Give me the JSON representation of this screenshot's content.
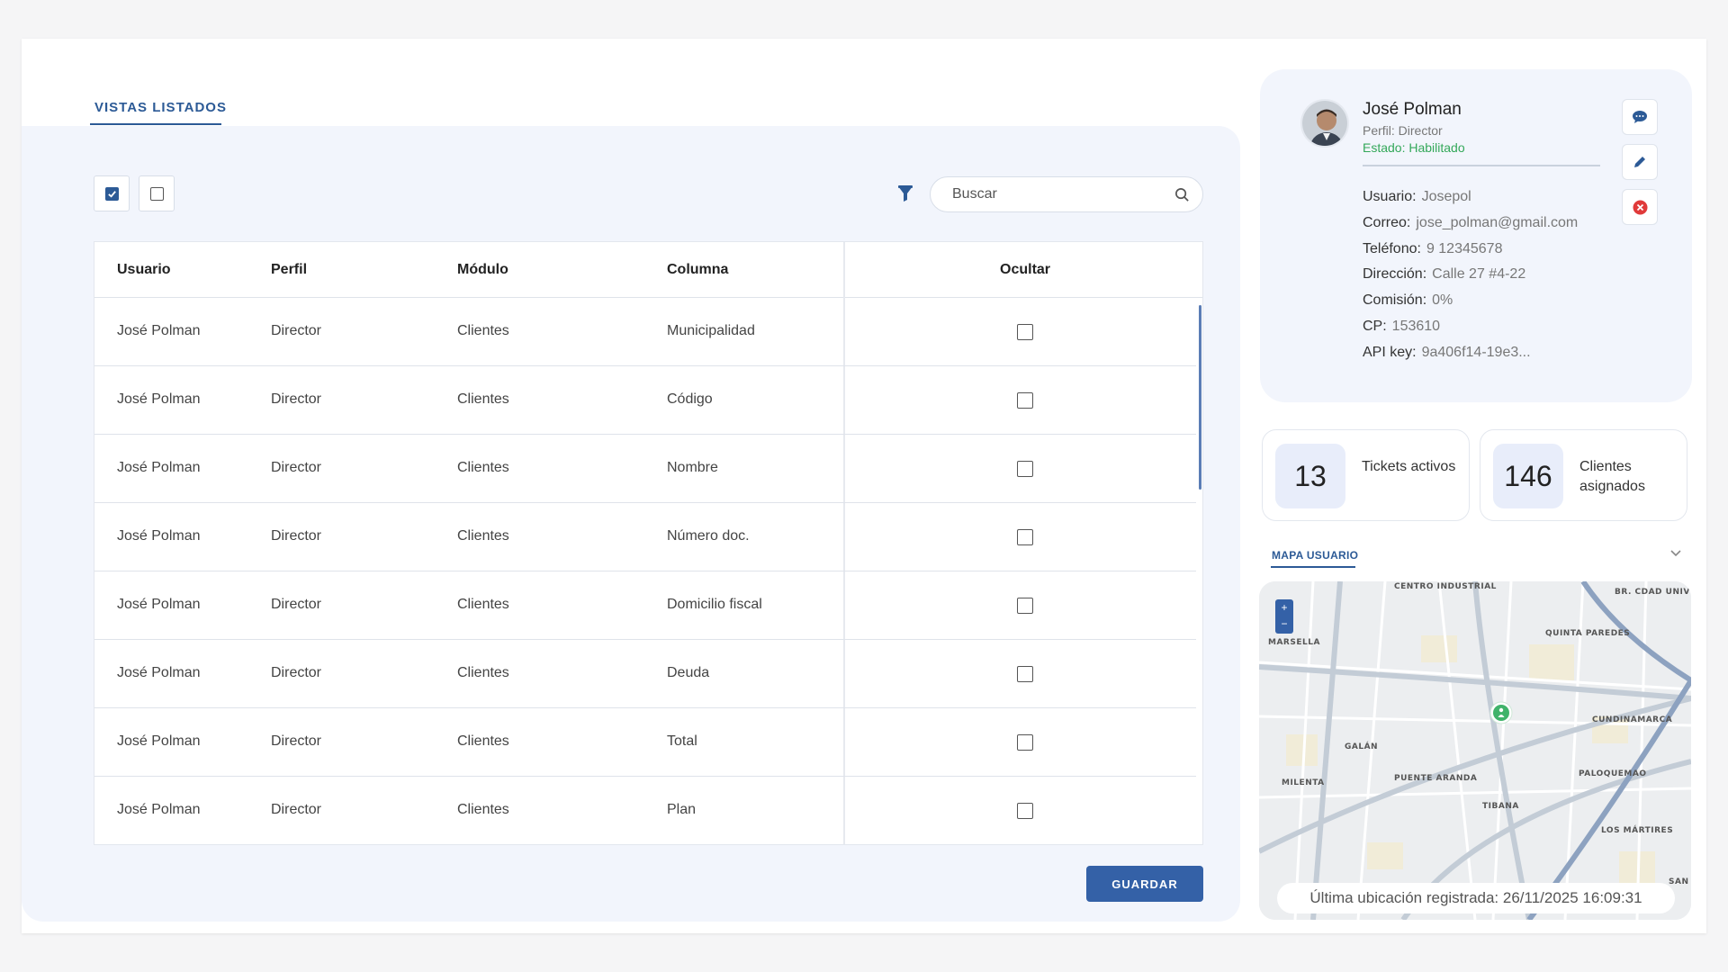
{
  "tab": {
    "label": "VISTAS LISTADOS"
  },
  "search": {
    "placeholder": "Buscar",
    "value": ""
  },
  "table": {
    "headers": {
      "usuario": "Usuario",
      "perfil": "Perfil",
      "modulo": "Módulo",
      "columna": "Columna",
      "ocultar": "Ocultar"
    },
    "rows": [
      {
        "usuario": "José Polman",
        "perfil": "Director",
        "modulo": "Clientes",
        "columna": "Municipalidad",
        "ocultar": false
      },
      {
        "usuario": "José Polman",
        "perfil": "Director",
        "modulo": "Clientes",
        "columna": "Código",
        "ocultar": false
      },
      {
        "usuario": "José Polman",
        "perfil": "Director",
        "modulo": "Clientes",
        "columna": "Nombre",
        "ocultar": false
      },
      {
        "usuario": "José Polman",
        "perfil": "Director",
        "modulo": "Clientes",
        "columna": "Número doc.",
        "ocultar": false
      },
      {
        "usuario": "José Polman",
        "perfil": "Director",
        "modulo": "Clientes",
        "columna": "Domicilio fiscal",
        "ocultar": false
      },
      {
        "usuario": "José Polman",
        "perfil": "Director",
        "modulo": "Clientes",
        "columna": "Deuda",
        "ocultar": false
      },
      {
        "usuario": "José Polman",
        "perfil": "Director",
        "modulo": "Clientes",
        "columna": "Total",
        "ocultar": false
      },
      {
        "usuario": "José Polman",
        "perfil": "Director",
        "modulo": "Clientes",
        "columna": "Plan",
        "ocultar": false
      }
    ]
  },
  "save_button": {
    "label": "GUARDAR"
  },
  "profile": {
    "name": "José Polman",
    "perfil": "Perfil: Director",
    "estado": "Estado: Habilitado",
    "fields": [
      {
        "key": "Usuario:",
        "value": "Josepol"
      },
      {
        "key": "Correo:",
        "value": "jose_polman@gmail.com"
      },
      {
        "key": "Teléfono:",
        "value": "9 12345678"
      },
      {
        "key": "Dirección:",
        "value": "Calle 27 #4-22"
      },
      {
        "key": "Comisión:",
        "value": "0%"
      },
      {
        "key": "CP:",
        "value": "153610"
      },
      {
        "key": "API key:",
        "value": "9a406f14-19e3..."
      }
    ]
  },
  "stats": [
    {
      "value": "13",
      "label": "Tickets activos"
    },
    {
      "value": "146",
      "label": "Clientes asignados"
    }
  ],
  "map": {
    "tab_label": "MAPA USUARIO",
    "caption": "Última ubicación registrada: 26/11/2025 16:09:31",
    "zoom_in": "+",
    "zoom_out": "−",
    "places": [
      "CENTRO INDUSTRIAL",
      "BR. CDAD UNIVERSITARIA",
      "MARSELLA",
      "QUINTA PAREDES",
      "CUNDINAMARCA",
      "GALÁN",
      "PUENTE ARANDA",
      "PALOQUEMAO",
      "MILENTA",
      "TIBANA",
      "LOS MÁRTIRES",
      "SAN VI"
    ]
  },
  "colors": {
    "accent": "#2c5a96",
    "button": "#3461a7",
    "status_ok": "#34a85a",
    "danger": "#e03a3a",
    "panel_bg": "#f2f5fc"
  },
  "icons": {
    "filter": "filter-icon",
    "search": "search-icon",
    "chat": "chat-icon",
    "edit": "pencil-icon",
    "delete": "close-circle-icon",
    "pin": "location-pin-icon",
    "chevron": "chevron-down-icon"
  }
}
